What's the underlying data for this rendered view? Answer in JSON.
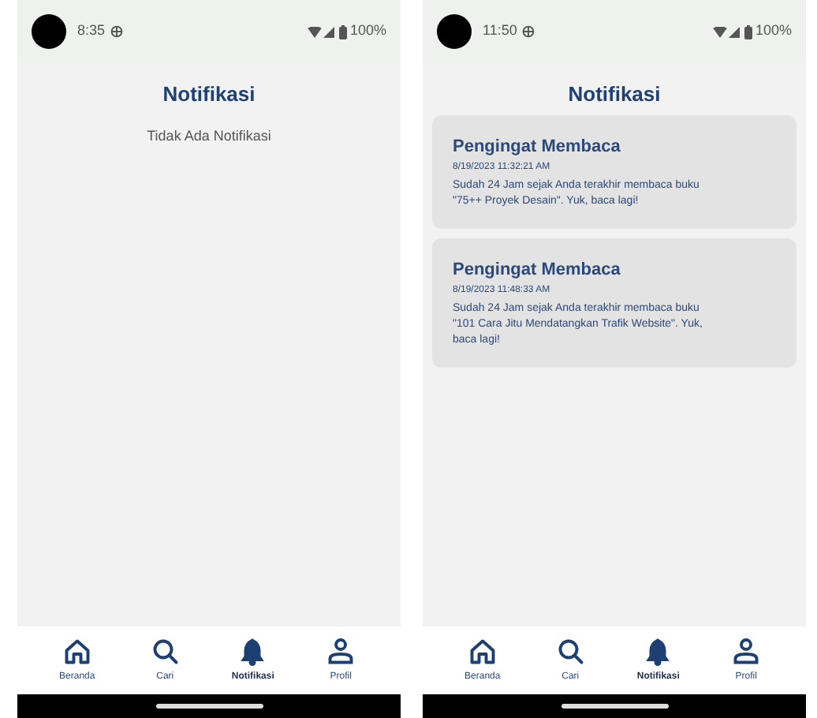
{
  "screens": [
    {
      "status_bar": {
        "time": "8:35",
        "battery": "100%"
      },
      "title": "Notifikasi",
      "empty_message": "Tidak Ada Notifikasi",
      "nav": [
        {
          "kind": "home",
          "label": "Beranda",
          "selected": false
        },
        {
          "kind": "search",
          "label": "Cari",
          "selected": false
        },
        {
          "kind": "bell",
          "label": "Notifikasi",
          "selected": true
        },
        {
          "kind": "person",
          "label": "Profil",
          "selected": false
        }
      ]
    },
    {
      "status_bar": {
        "time": "11:50",
        "battery": "100%"
      },
      "title": "Notifikasi",
      "notifications": [
        {
          "title": "Pengingat Membaca",
          "date": "8/19/2023 11:32:21 AM",
          "body": "Sudah 24 Jam sejak Anda terakhir membaca buku \"75++ Proyek Desain\". Yuk, baca lagi!"
        },
        {
          "title": "Pengingat Membaca",
          "date": "8/19/2023 11:48:33 AM",
          "body": "Sudah 24 Jam sejak Anda terakhir membaca buku \"101 Cara Jitu Mendatangkan Trafik Website\". Yuk, baca lagi!"
        }
      ],
      "nav": [
        {
          "kind": "home",
          "label": "Beranda",
          "selected": false
        },
        {
          "kind": "search",
          "label": "Cari",
          "selected": false
        },
        {
          "kind": "bell",
          "label": "Notifikasi",
          "selected": true
        },
        {
          "kind": "person",
          "label": "Profil",
          "selected": false
        }
      ]
    }
  ]
}
